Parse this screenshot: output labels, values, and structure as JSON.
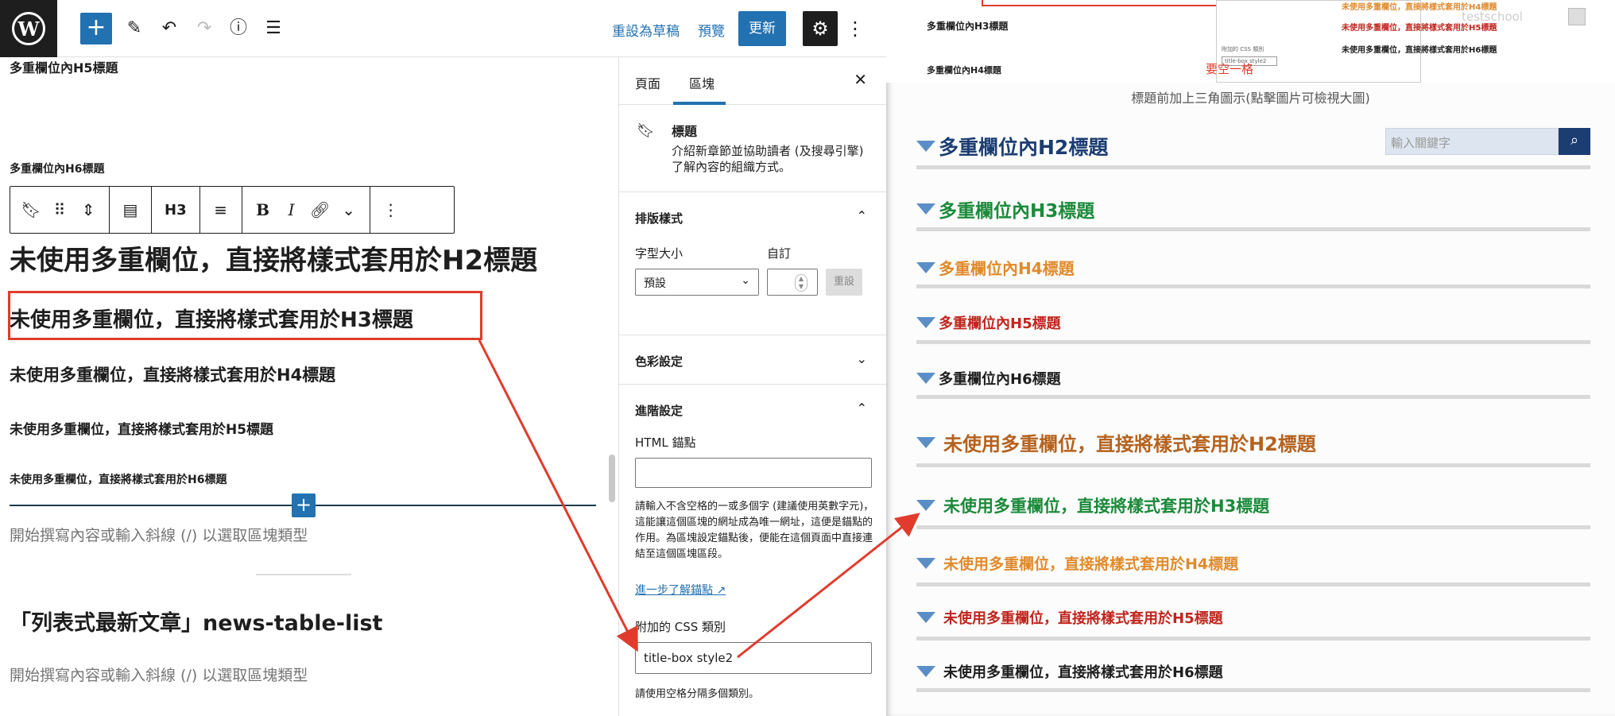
{
  "topbar": {
    "logo_letter": "W",
    "add_icon": "plus-icon",
    "draft_label": "重設為草稿",
    "preview_label": "預覽",
    "update_label": "更新"
  },
  "canvas": {
    "headings": [
      "多重欄位內H5標題",
      "多重欄位內H6標題",
      "未使用多重欄位，直接將樣式套用於H2標題",
      "未使用多重欄位，直接將樣式套用於H3標題",
      "未使用多重欄位，直接將樣式套用於H4標題",
      "未使用多重欄位，直接將樣式套用於H5標題",
      "未使用多重欄位，直接將樣式套用於H6標題"
    ],
    "h2_visible_tail": "於H2標題",
    "placeholder": "開始撰寫內容或輸入斜線 (/) 以選取區塊類型",
    "section_title": "「列表式最新文章」news-table-list",
    "toolbar_heading_level": "H3"
  },
  "sidebar": {
    "tab_page": "頁面",
    "tab_block": "區塊",
    "block_name": "標題",
    "block_desc": "介紹新章節並協助讀者 (及搜尋引擎) 了解內容的組織方式。",
    "typography_title": "排版樣式",
    "font_size_label": "字型大小",
    "custom_label": "自訂",
    "font_size_value": "預設",
    "reset_label": "重設",
    "color_title": "色彩設定",
    "advanced_title": "進階設定",
    "html_anchor_label": "HTML 錨點",
    "html_anchor_help": "請輸入不含空格的一或多個字 (建議使用英數字元)，這能讓這個區塊的網址成為唯一網址，這便是錨點的作用。為區塊設定錨點後，便能在這個頁面中直接連結至這個區塊區段。",
    "learn_more": "進一步了解錨點",
    "css_class_label": "附加的 CSS 類別",
    "css_class_value": "title-box style2",
    "css_class_help": "請使用空格分隔多個類別。"
  },
  "preview": {
    "thumb_h3": "多重欄位內H3標題",
    "thumb_h4": "多重欄位內H4標題",
    "thumb_note": "要空一格",
    "thumb_ghost": "testschool",
    "thumb_rows": [
      "未使用多重欄位，直接將樣式套用於H4標題",
      "未使用多重欄位，直接將樣式套用於H5標題",
      "未使用多重欄位，直接將樣式套用於H6標題"
    ],
    "thumb_mini_text": "附加的 CSS 類別",
    "thumb_mini_value": "title-box style2",
    "caption": "標題前加上三角圖示(點擊圖片可檢視大圖)",
    "search_placeholder": "輸入關鍵字",
    "headings": [
      {
        "text": "多重欄位內H2標題",
        "color": "#1c3d72"
      },
      {
        "text": "多重欄位內H3標題",
        "color": "#1b8a3a"
      },
      {
        "text": "多重欄位內H4標題",
        "color": "#e08a2c"
      },
      {
        "text": "多重欄位內H5標題",
        "color": "#c0251d"
      },
      {
        "text": "多重欄位內H6標題",
        "color": "#1e1e1e"
      },
      {
        "text": "未使用多重欄位，直接將樣式套用於H2標題",
        "color": "#b5621e"
      },
      {
        "text": "未使用多重欄位，直接將樣式套用於H3標題",
        "color": "#1b8a3a"
      },
      {
        "text": "未使用多重欄位，直接將樣式套用於H4標題",
        "color": "#e08a2c"
      },
      {
        "text": "未使用多重欄位，直接將樣式套用於H5標題",
        "color": "#c0251d"
      },
      {
        "text": "未使用多重欄位，直接將樣式套用於H6標題",
        "color": "#1e1e1e"
      }
    ]
  },
  "colors": {
    "accent": "#2271b1",
    "highlight": "#e03b2c"
  }
}
